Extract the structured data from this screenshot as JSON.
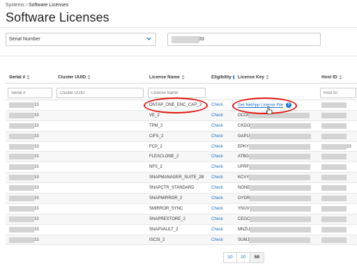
{
  "breadcrumb": {
    "parent": "Systems",
    "separator": ">",
    "current": "Software Licenses"
  },
  "page_title": "Software Licenses",
  "filter": {
    "field": "Serial Number",
    "value_suffix": "33"
  },
  "table": {
    "columns": [
      {
        "label": "Serial #",
        "sortable": true
      },
      {
        "label": "Cluster UUID",
        "sortable": true
      },
      {
        "label": "License Name",
        "sortable": true
      },
      {
        "label": "Eligibility",
        "sortable": false,
        "info": true
      },
      {
        "label": "License Key",
        "sortable": true
      },
      {
        "label": "Host ID",
        "sortable": true
      }
    ],
    "filter_placeholders": {
      "serial": "Serial #",
      "cluster": "Cluster UUID",
      "license": "License Name",
      "host": "Host ID"
    },
    "check_label": "Check",
    "get_file_label": "Get NetApp License File",
    "rows": [
      {
        "serial_suffix": "33",
        "license": "ONTAP_ONE_ENC_CAP_3",
        "key_prefix": "",
        "host_suffix": ""
      },
      {
        "serial_suffix": "33",
        "license": "VE_2",
        "key_prefix": "OCOI",
        "host_suffix": ""
      },
      {
        "serial_suffix": "33",
        "license": "TPM_2",
        "key_prefix": "CKDO",
        "host_suffix": ""
      },
      {
        "serial_suffix": "33",
        "license": "CIFS_2",
        "key_prefix": "GAPU",
        "host_suffix": ""
      },
      {
        "serial_suffix": "33",
        "license": "FCP_2",
        "key_prefix": "EPKY",
        "host_suffix": "33"
      },
      {
        "serial_suffix": "33",
        "license": "FLEXCLONE_2",
        "key_prefix": "ATBG",
        "host_suffix": ""
      },
      {
        "serial_suffix": "33",
        "license": "NFS_2",
        "key_prefix": "UFRF",
        "host_suffix": ""
      },
      {
        "serial_suffix": "33",
        "license": "SNAPMANAGER_SUITE_2B",
        "key_prefix": "KCVY",
        "host_suffix": ""
      },
      {
        "serial_suffix": "33",
        "license": "SNAPCTR_STANDARD",
        "key_prefix": "NONE",
        "host_suffix": ""
      },
      {
        "serial_suffix": "33",
        "license": "SNAPMIRROR_2",
        "key_prefix": "OYDR",
        "host_suffix": ""
      },
      {
        "serial_suffix": "33",
        "license": "SMIRROR_SYNC",
        "key_prefix": "YNUV",
        "host_suffix": ""
      },
      {
        "serial_suffix": "33",
        "license": "SNAPRESTORE_2",
        "key_prefix": "CEGC",
        "host_suffix": ""
      },
      {
        "serial_suffix": "33",
        "license": "SNAPVAULT_2",
        "key_prefix": "MNZU",
        "host_suffix": ""
      },
      {
        "serial_suffix": "33",
        "license": "ISCSI_2",
        "key_prefix": "SUMJ",
        "host_suffix": ""
      }
    ]
  },
  "pagination": {
    "options": [
      "10",
      "20",
      "50"
    ],
    "selected": "50"
  },
  "colors": {
    "link": "#1e6fc0",
    "annotation": "#e3120b",
    "info": "#1e78c8"
  }
}
